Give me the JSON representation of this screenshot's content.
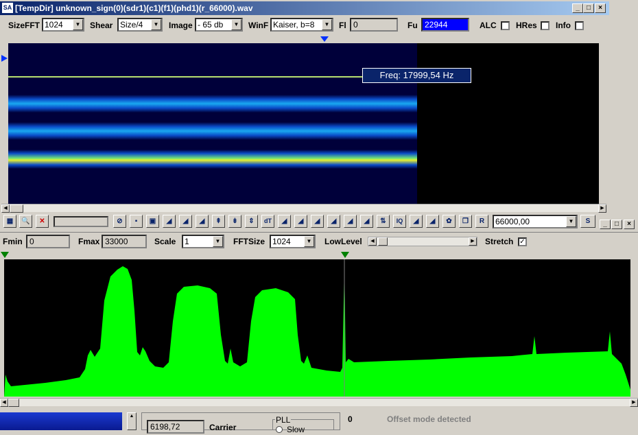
{
  "window": {
    "title": "[TempDir] unknown_sign(0)(sdr1)(c1)(f1)(phd1)(r_66000).wav",
    "icon_text": "SA"
  },
  "toolbar": {
    "sizefft_label": "SizeFFT",
    "sizefft_value": "1024",
    "shear_label": "Shear",
    "shear_value": "Size/4",
    "image_label": "Image",
    "image_value": "- 65 db",
    "winf_label": "WinF",
    "winf_value": "Kaiser, b=8",
    "fl_label": "Fl",
    "fl_value": "0",
    "fu_label": "Fu",
    "fu_value": "22944",
    "alc_label": "ALC",
    "hres_label": "HRes",
    "info_label": "Info"
  },
  "waterfall": {
    "freq_tooltip": "Freq: 17999,54 Hz"
  },
  "tools": {
    "rate_value": "66000,00",
    "s_label": "S",
    "r_label": "R",
    "dt_label": "dT",
    "iq_label": "IQ"
  },
  "spectrum_bar": {
    "fmin_label": "Fmin",
    "fmin_value": "0",
    "fmax_label": "Fmax",
    "fmax_value": "33000",
    "scale_label": "Scale",
    "scale_value": "1",
    "fftsize_label": "FFTSize",
    "fftsize_value": "1024",
    "lowlevel_label": "LowLevel",
    "stretch_label": "Stretch"
  },
  "bottom": {
    "carrier_value": "6198,72",
    "carrier_label": "Carrier",
    "pll_label": "PLL",
    "slow_label": "Slow",
    "zero": "0",
    "offset_text": "Offset mode detected"
  },
  "colors": {
    "spectrum": "#00ff00",
    "waterfall_bg": "#000050",
    "title_start": "#0a246a",
    "fu_field": "#0000ff"
  }
}
